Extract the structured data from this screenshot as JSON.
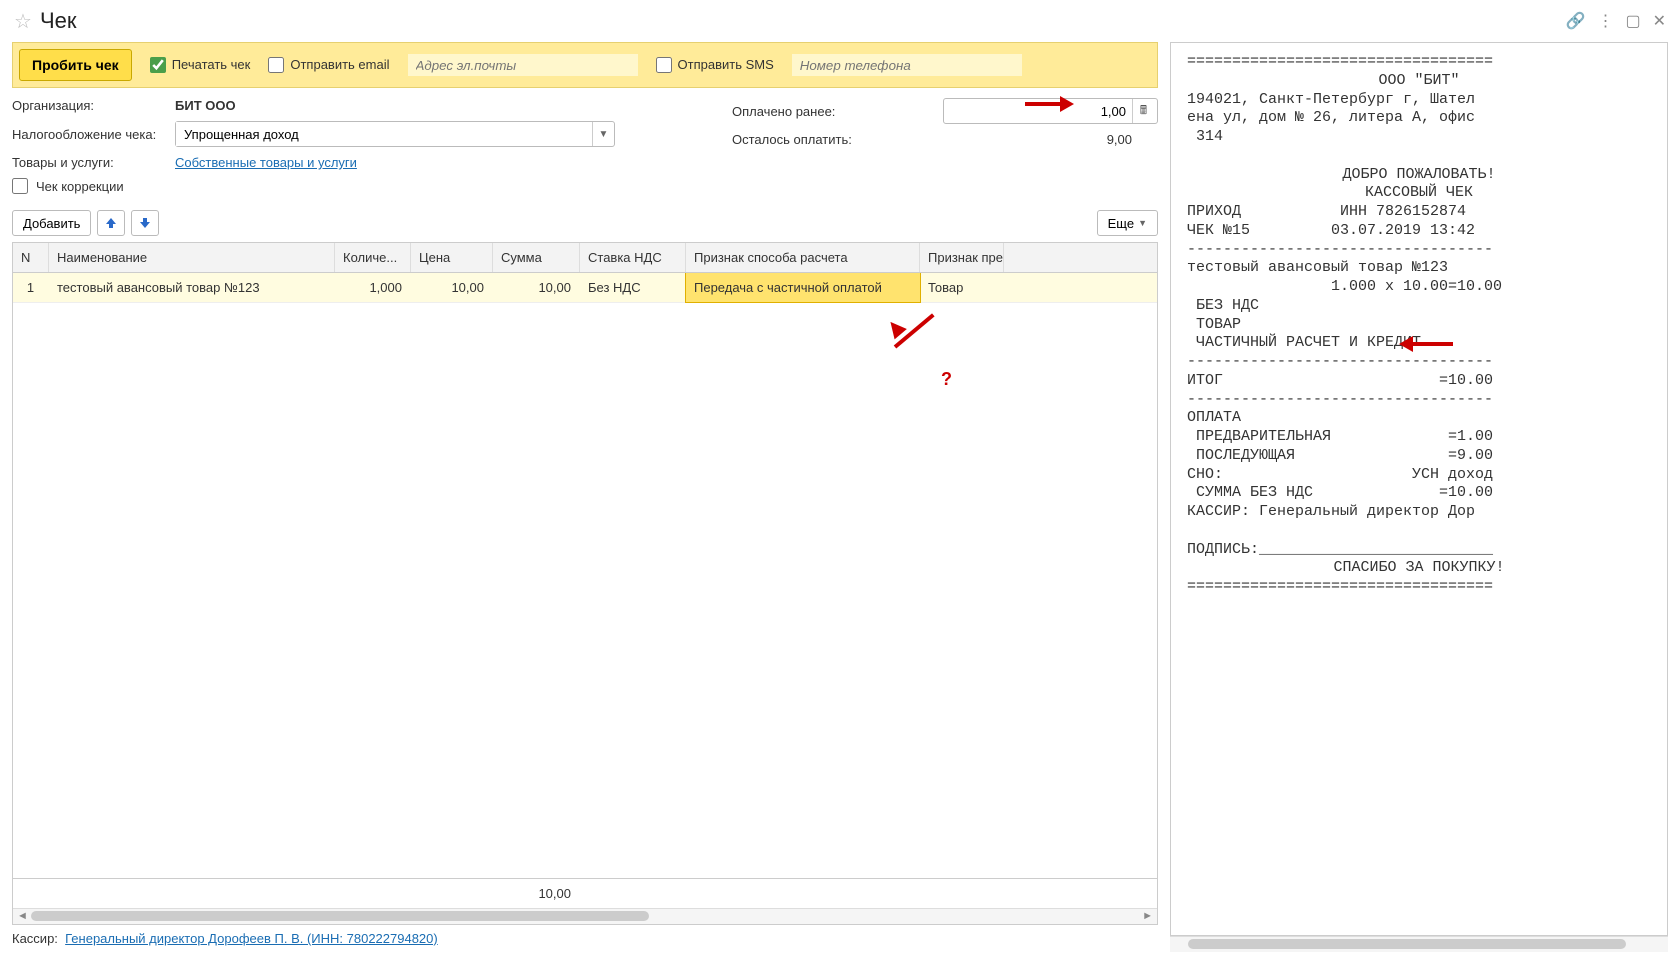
{
  "title": "Чек",
  "yellow_bar": {
    "punch": "Пробить чек",
    "print": "Печатать чек",
    "print_checked": true,
    "send_email": "Отправить email",
    "email_placeholder": "Адрес эл.почты",
    "send_sms": "Отправить SMS",
    "phone_placeholder": "Номер телефона"
  },
  "form": {
    "org_label": "Организация:",
    "org_value": "БИТ ООО",
    "tax_label": "Налогообложение чека:",
    "tax_value": "Упрощенная доход",
    "goods_label": "Товары и услуги:",
    "goods_link": "Собственные товары и услуги",
    "correction_label": "Чек коррекции",
    "paid_before_label": "Оплачено ранее:",
    "paid_before_value": "1,00",
    "left_to_pay_label": "Осталось оплатить:",
    "left_to_pay_value": "9,00"
  },
  "toolbar": {
    "add": "Добавить",
    "more": "Еще"
  },
  "table": {
    "headers": {
      "n": "N",
      "name": "Наименование",
      "qty": "Количе...",
      "price": "Цена",
      "sum": "Сумма",
      "vat": "Ставка НДС",
      "method": "Признак способа расчета",
      "subject": "Признак пре"
    },
    "rows": [
      {
        "n": "1",
        "name": "тестовый авансовый товар №123",
        "qty": "1,000",
        "price": "10,00",
        "sum": "10,00",
        "vat": "Без НДС",
        "method": "Передача с частичной оплатой",
        "subject": "Товар"
      }
    ],
    "footer_sum": "10,00"
  },
  "annotation_qm": "?",
  "cashier": {
    "label": "Кассир:",
    "link": "Генеральный директор Дорофеев П. В. (ИНН: 780222794820)"
  },
  "receipt": {
    "sep": "==================================",
    "company": "ООО \"БИТ\"",
    "addr1": "194021, Санкт-Петербург г, Шател",
    "addr2": "ена ул, дом № 26, литера А, офис",
    "addr3": " 314",
    "welcome": "ДОБРО ПОЖАЛОВАТЬ!",
    "title": "КАССОВЫЙ ЧЕК",
    "prihod": "ПРИХОД           ИНН 7826152874",
    "check_dt": "ЧЕК №15         03.07.2019 13:42",
    "dashes": "----------------------------------",
    "item1": "тестовый авансовый товар №123",
    "item2": "                1.000 x 10.00=10.00",
    "no_vat": " БЕЗ НДС",
    "tovar": " ТОВАР",
    "partial": " ЧАСТИЧНЫЙ РАСЧЕТ И КРЕДИТ",
    "itog": "ИТОГ                        =10.00",
    "oplata": "ОПЛАТА",
    "predv": " ПРЕДВАРИТЕЛЬНАЯ             =1.00",
    "posled": " ПОСЛЕДУЮЩАЯ                 =9.00",
    "sno": "СНО:                     УСН доход",
    "sum_no_vat": " СУММА БЕЗ НДС              =10.00",
    "kassir": "КАССИР: Генеральный директор Дор",
    "sign": "ПОДПИСЬ:__________________________",
    "thanks": "СПАСИБО ЗА ПОКУПКУ!"
  }
}
